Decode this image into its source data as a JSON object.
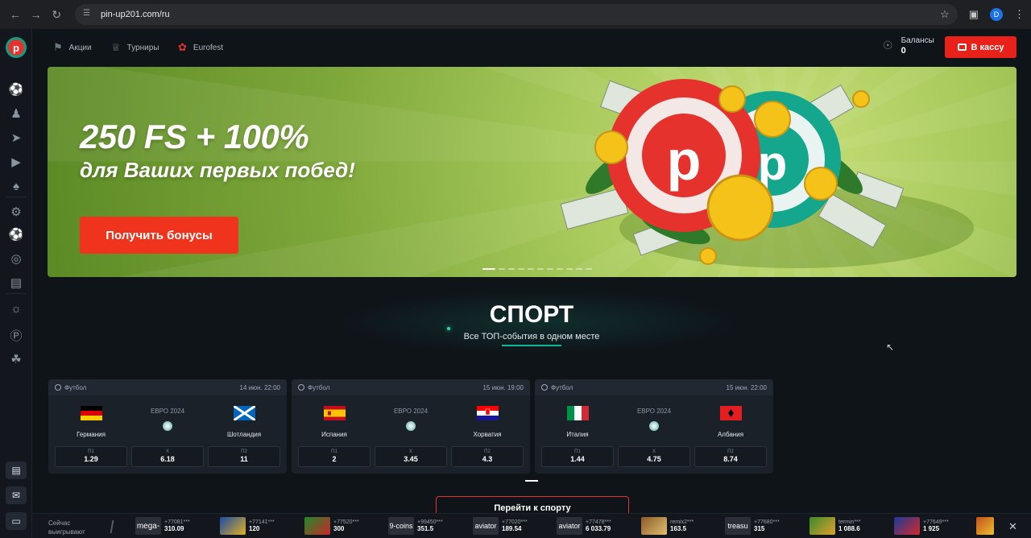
{
  "browser": {
    "url": "pin-up201.com/ru",
    "profile_initial": "D"
  },
  "nav": {
    "promos": "Акции",
    "tournaments": "Турниры",
    "eurofest": "Eurofest",
    "balance_label": "Балансы",
    "balance_value": "0",
    "cashier": "В кассу"
  },
  "hero": {
    "title": "250 FS + 100%",
    "subtitle": "для Ваших первых побед!",
    "button": "Получить бонусы"
  },
  "sport": {
    "title": "СПОРТ",
    "subtitle": "Все ТОП-события в одном месте",
    "goto": "Перейти к спорту"
  },
  "matches": [
    {
      "sport": "Футбол",
      "datetime": "14 июн. 22:00",
      "tournament": "ЕВРО 2024",
      "home": "Германия",
      "away": "Шотландия",
      "odds": [
        {
          "k": "П1",
          "v": "1.29"
        },
        {
          "k": "Х",
          "v": "6.18"
        },
        {
          "k": "П2",
          "v": "11"
        }
      ]
    },
    {
      "sport": "Футбол",
      "datetime": "15 июн. 19:00",
      "tournament": "ЕВРО 2024",
      "home": "Испания",
      "away": "Хорватия",
      "odds": [
        {
          "k": "П1",
          "v": "2"
        },
        {
          "k": "Х",
          "v": "3.45"
        },
        {
          "k": "П2",
          "v": "4.3"
        }
      ]
    },
    {
      "sport": "Футбол",
      "datetime": "15 июн. 22:00",
      "tournament": "ЕВРО 2024",
      "home": "Италия",
      "away": "Албания",
      "odds": [
        {
          "k": "П1",
          "v": "1.44"
        },
        {
          "k": "Х",
          "v": "4.75"
        },
        {
          "k": "П2",
          "v": "8.74"
        }
      ]
    }
  ],
  "ticker": {
    "title_line1": "Сейчас",
    "title_line2": "выигрывают",
    "winners": [
      {
        "game": "mega-",
        "user": "+77081***",
        "amount": "310.09"
      },
      {
        "game": "",
        "user": "+77141***",
        "amount": "120"
      },
      {
        "game": "",
        "user": "+77520***",
        "amount": "300"
      },
      {
        "game": "9-coins",
        "user": "+99450***",
        "amount": "351.5"
      },
      {
        "game": "aviator",
        "user": "+77020***",
        "amount": "189.54"
      },
      {
        "game": "aviator",
        "user": "+77478***",
        "amount": "6 033.79"
      },
      {
        "game": "",
        "user": "remix2***",
        "amount": "163.5"
      },
      {
        "game": "treasu",
        "user": "+77680***",
        "amount": "315"
      },
      {
        "game": "",
        "user": "termin***",
        "amount": "1 088.6"
      },
      {
        "game": "",
        "user": "+77649***",
        "amount": "1 925"
      }
    ]
  },
  "colors": {
    "accent_red": "#e8221a",
    "accent_teal": "#17b39a",
    "bg": "#0f1419"
  }
}
